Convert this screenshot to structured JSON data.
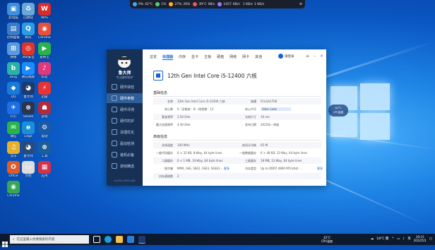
{
  "topbar": {
    "cpu": "9%",
    "cpu_temp": "42°C",
    "mem": "1%",
    "gpu": "27%",
    "gpu_temp": "26%",
    "disk": "39°C",
    "disk_v": "0B/s",
    "net_up": "1457",
    "net_up_unit": "KB/s",
    "speed1": "1 KB/s",
    "speed2": "1 KB/s"
  },
  "desktop_icons": [
    {
      "label": "此电脑",
      "color": "#3d8fe0",
      "glyph": "▣"
    },
    {
      "label": "回收站",
      "color": "#6aa6d8",
      "glyph": "♻"
    },
    {
      "label": "WPS",
      "color": "#d92b2b",
      "glyph": "W"
    },
    {
      "label": "控制面板",
      "color": "#3b7cc9",
      "glyph": "▤"
    },
    {
      "label": "腾讯",
      "color": "#2a9be8",
      "glyph": "Q"
    },
    {
      "label": "Chrome",
      "color": "#e8503a",
      "glyph": "◉"
    },
    {
      "label": "网络",
      "color": "#5a9be0",
      "glyph": "⊞"
    },
    {
      "label": "360安全",
      "color": "#e0342a",
      "glyph": "◎"
    },
    {
      "label": "爱奇艺",
      "color": "#29b34a",
      "glyph": "▶"
    },
    {
      "label": "Bing",
      "color": "#2bb2a6",
      "glyph": "b"
    },
    {
      "label": "腾讯视频",
      "color": "#1a8cff",
      "glyph": "▶"
    },
    {
      "label": "抖音",
      "color": "#e0387a",
      "glyph": "♪"
    },
    {
      "label": "QQ",
      "color": "#1a7ad8",
      "glyph": "◆"
    },
    {
      "label": "鲁大师",
      "color": "#1f3a6a",
      "glyph": "◕"
    },
    {
      "label": "迅雷",
      "color": "#e63333",
      "glyph": "⚡"
    },
    {
      "label": "钉钉",
      "color": "#1e6fe3",
      "glyph": "✈"
    },
    {
      "label": "Steam",
      "color": "#2a3550",
      "glyph": "⊛"
    },
    {
      "label": "游戏",
      "color": "#b32a3a",
      "glyph": "☗"
    },
    {
      "label": "微信",
      "color": "#2ab34a",
      "glyph": "✉"
    },
    {
      "label": "Edge",
      "color": "#1a8fd8",
      "glyph": "e"
    },
    {
      "label": "驱动",
      "color": "#1a5aa8",
      "glyph": "⚙"
    },
    {
      "label": "音乐",
      "color": "#e8b02a",
      "glyph": "♫"
    },
    {
      "label": "鲁大师",
      "color": "#2a4a7a",
      "glyph": "◕"
    },
    {
      "label": "工具",
      "color": "#1a5e9a",
      "glyph": "⊕"
    },
    {
      "label": "Office",
      "color": "#e05a2a",
      "glyph": "O"
    },
    {
      "label": "文档",
      "color": "#ddd",
      "glyph": "▭"
    },
    {
      "label": "应用",
      "color": "#d8304a",
      "glyph": "▦"
    },
    {
      "label": "Chrome",
      "color": "#34a853",
      "glyph": "◉"
    }
  ],
  "app": {
    "brand": "鲁大师",
    "brand_sub": "专注硬件防护",
    "version": "6.1022.3330.426",
    "nav": [
      "硬件体检",
      "硬件参数",
      "硬件评测",
      "硬件防护",
      "清理优化",
      "驱动检测",
      "装机必备",
      "游戏精选"
    ],
    "tabs": [
      "总览",
      "处理器",
      "内存",
      "显卡",
      "主板",
      "硬盘",
      "网络",
      "网卡",
      "其他"
    ],
    "login": "请登录",
    "cpu_title": "12th Gen Intel Core i5-12400 六核",
    "section_basic": "基础信息",
    "basic_rows": [
      {
        "k1": "名称",
        "v1": "12th Gen Intel Core i5-12400 六核",
        "k2": "插槽",
        "v2": "FCLGA1700"
      },
      {
        "k1": "核心数",
        "v1": "6（全能核：6）/线程数：12",
        "k2": "核心代号",
        "v2": "Alder Lake"
      },
      {
        "k1": "基准频率",
        "v1": "2.50 GHz",
        "k2": "光刻尺寸",
        "v2": "10 nm"
      },
      {
        "k1": "最大加速频率",
        "v1": "4.40 GHz",
        "k2": "发布日期",
        "v2": "2022年一季度"
      }
    ],
    "section_adv": "高级信息",
    "adv_rows": [
      {
        "k1": "总线速度",
        "v1": "100 MHz",
        "k2": "热设计功耗",
        "v2": "65 W"
      },
      {
        "k1": "一级代码缓存",
        "v1": "6 × 32 KB, 8-Way, 64 byte lines",
        "k2": "一级数据缓存",
        "v2": "6 × 48 KB, 12-Way, 64 byte lines"
      },
      {
        "k1": "二级缓存",
        "v1": "6 × 1 MB, 10-Way, 64 byte lines",
        "k2": "三级缓存",
        "v2": "18 MB, 12-Way, 64 byte lines"
      },
      {
        "k1": "指令集",
        "v1": "MMX, SSE, SSE2, SSE3, SSSE3 …",
        "k2": "内存类型",
        "v2": "Up to DDR5 4800 MT/s/ddr …"
      },
      {
        "k1": "内存通道数",
        "v1": "2",
        "k2": "",
        "v2": ""
      }
    ],
    "more": "更多"
  },
  "float_widget": {
    "temp": "42°C",
    "label": "CPU温度"
  },
  "taskbar": {
    "search_placeholder": "在这里输入你要搜索的内容",
    "cpu_temp": "42°C",
    "cpu_label": "CPU温度",
    "weather": "18°C 雾",
    "time": "20:15",
    "date": "2022/5/1",
    "lang": "英"
  }
}
